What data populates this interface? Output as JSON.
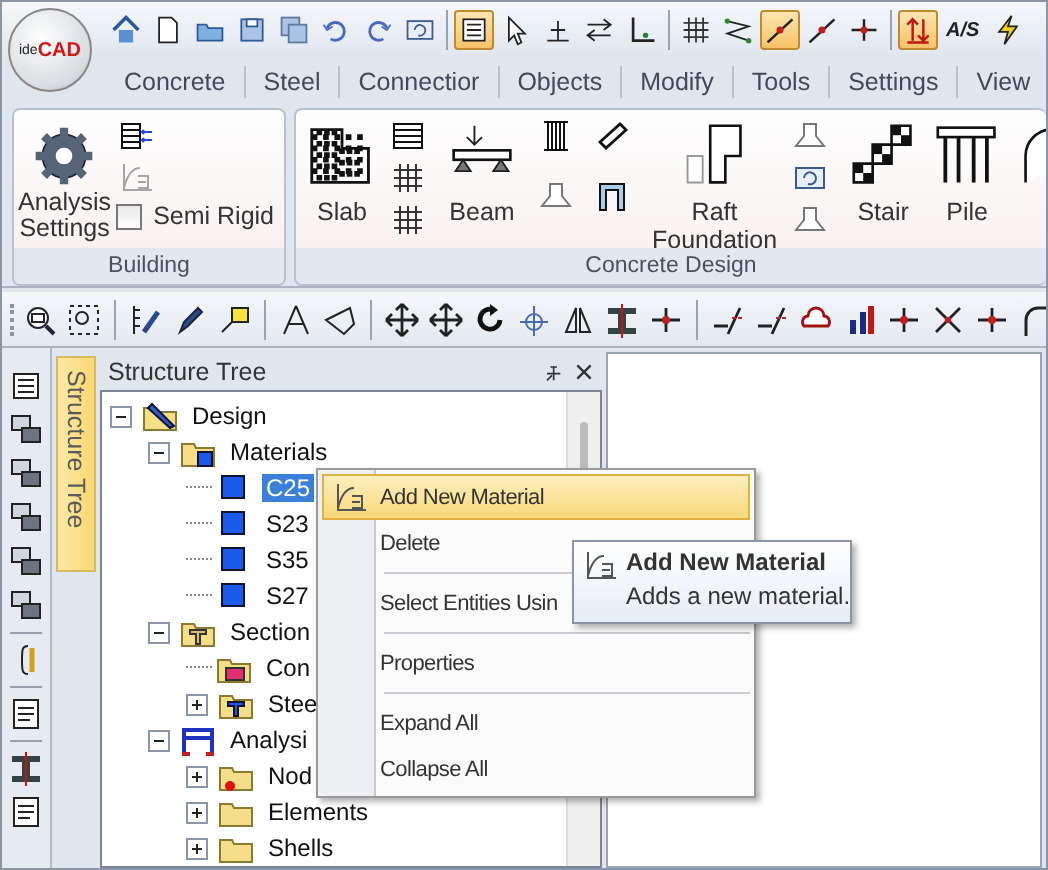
{
  "logo": {
    "prefix": "ide",
    "name": "CAD"
  },
  "quick_access": [
    {
      "selected": false
    },
    {
      "selected": false
    },
    {
      "selected": false
    },
    {
      "selected": false
    },
    {
      "selected": false
    },
    {
      "selected": false
    },
    {
      "selected": false
    },
    {
      "selected": false
    },
    {
      "selected": true
    },
    {
      "selected": false
    },
    {
      "selected": false
    },
    {
      "selected": false
    },
    {
      "selected": false
    },
    {
      "selected": false
    },
    {
      "selected": false
    },
    {
      "selected": true
    },
    {
      "selected": false
    },
    {
      "selected": false
    },
    {
      "selected": true
    },
    {
      "selected": false,
      "label": "A/S"
    },
    {
      "selected": false
    }
  ],
  "tabs": [
    {
      "label": "Concrete",
      "selected": false
    },
    {
      "label": "Steel",
      "selected": false
    },
    {
      "label": "Connectior",
      "selected": false
    },
    {
      "label": "Objects",
      "selected": false
    },
    {
      "label": "Modify",
      "selected": false
    },
    {
      "label": "Tools",
      "selected": false
    },
    {
      "label": "Settings",
      "selected": false
    },
    {
      "label": "View",
      "selected": false
    }
  ],
  "ribbon": [
    {
      "title": "Building",
      "items": [
        {
          "kind": "large",
          "label": "Analysis Settings"
        },
        {
          "kind": "stackcheck",
          "label": "Semi Rigid",
          "checked": false
        }
      ]
    },
    {
      "title": "Concrete Design",
      "items": [
        {
          "kind": "large",
          "label": "Slab"
        },
        {
          "kind": "stack"
        },
        {
          "kind": "separator"
        },
        {
          "kind": "large",
          "label": "Beam"
        },
        {
          "kind": "separator"
        },
        {
          "kind": "pair"
        },
        {
          "kind": "separator"
        },
        {
          "kind": "pair"
        },
        {
          "kind": "separator"
        },
        {
          "kind": "large",
          "label": "Raft Foundation"
        },
        {
          "kind": "stack"
        },
        {
          "kind": "separator"
        },
        {
          "kind": "large",
          "label": "Stair"
        },
        {
          "kind": "large",
          "label": "Pile"
        },
        {
          "kind": "large"
        }
      ]
    }
  ],
  "side_tab": {
    "label": "Structure Tree",
    "selected": true
  },
  "panel": {
    "title": "Structure Tree",
    "tree": [
      {
        "label": "Design",
        "kind": "design",
        "expanded": true,
        "selected": false,
        "children": [
          {
            "label": "Materials",
            "kind": "materials",
            "expanded": true,
            "selected": false,
            "children": [
              {
                "label": "C25",
                "kind": "material",
                "selected": true
              },
              {
                "label": "S23",
                "kind": "material",
                "selected": false
              },
              {
                "label": "S35",
                "kind": "material",
                "selected": false
              },
              {
                "label": "S27",
                "kind": "material",
                "selected": false
              }
            ]
          },
          {
            "label": "Section",
            "kind": "sections",
            "expanded": true,
            "selected": false,
            "children": [
              {
                "label": "Con",
                "kind": "concrete-folder",
                "selected": false
              },
              {
                "label": "Stee",
                "kind": "steel-folder",
                "expanded": false,
                "selected": false
              }
            ]
          },
          {
            "label": "Analysi",
            "kind": "analysis",
            "expanded": true,
            "selected": false,
            "children": [
              {
                "label": "Nod",
                "kind": "nodes-folder",
                "expanded": false,
                "selected": false
              },
              {
                "label": "Elements",
                "kind": "folder",
                "expanded": false,
                "selected": false
              },
              {
                "label": "Shells",
                "kind": "folder",
                "expanded": false,
                "selected": false
              }
            ]
          }
        ]
      }
    ]
  },
  "context_menu": [
    {
      "kind": "item",
      "label": "Add New Material",
      "selected": true,
      "icon": true
    },
    {
      "kind": "item",
      "label": "Delete",
      "selected": false
    },
    {
      "kind": "separator"
    },
    {
      "kind": "item",
      "label": "Select Entities Usin",
      "selected": false
    },
    {
      "kind": "separator"
    },
    {
      "kind": "item",
      "label": "Properties",
      "selected": false
    },
    {
      "kind": "separator"
    },
    {
      "kind": "item",
      "label": "Expand All",
      "selected": false
    },
    {
      "kind": "item",
      "label": "Collapse All",
      "selected": false
    }
  ],
  "tooltip": {
    "title": "Add New Material",
    "text": "Adds a new material."
  }
}
